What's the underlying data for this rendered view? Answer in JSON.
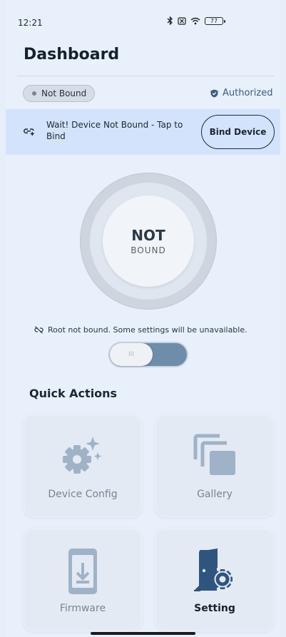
{
  "status_bar": {
    "time": "12:21",
    "battery": "77"
  },
  "header": {
    "title": "Dashboard"
  },
  "status": {
    "bind_label": "Not Bound",
    "auth_label": "Authorized"
  },
  "banner": {
    "message": "Wait! Device Not Bound - Tap to Bind",
    "button_label": "Bind Device"
  },
  "indicator": {
    "main": "NOT",
    "sub": "BOUND"
  },
  "root_note": "Root not bound. Some settings will be unavailable.",
  "toggle": {
    "knob_mark": "III"
  },
  "quick_actions": {
    "title": "Quick Actions",
    "items": [
      {
        "label": "Device Config",
        "icon": "settings-sparkle-icon",
        "enabled": false
      },
      {
        "label": "Gallery",
        "icon": "gallery-icon",
        "enabled": false
      },
      {
        "label": "Firmware",
        "icon": "firmware-download-icon",
        "enabled": false
      },
      {
        "label": "Setting",
        "icon": "door-gear-icon",
        "enabled": true
      }
    ]
  },
  "colors": {
    "accent": "#3f5c7f",
    "disabled_icon": "#9fb2c8",
    "active_icon": "#2f557f",
    "banner_bg": "#d3e3fb"
  }
}
